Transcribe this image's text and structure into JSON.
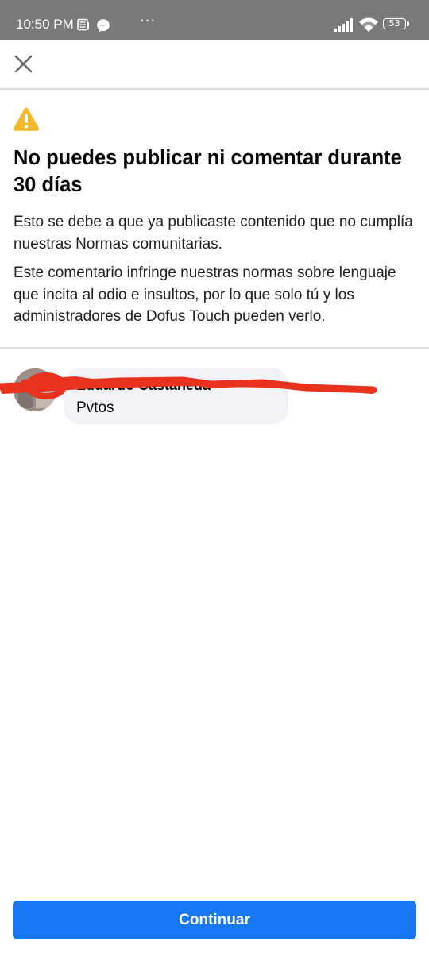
{
  "status_bar": {
    "time": "10:50 PM",
    "icons": [
      "news-icon",
      "messenger-icon",
      "more-dots-icon",
      "signal-icon",
      "wifi-icon",
      "battery-icon"
    ],
    "more": "···",
    "battery": "53",
    "background": "#7a7a7a"
  },
  "top_bar": {
    "close_icon": "close-icon"
  },
  "restriction": {
    "icon": "warning-icon",
    "icon_color": "#f7b928",
    "title": "No puedes publicar ni comentar durante 30 días",
    "paragraph_1": "Esto se debe a que ya publicaste contenido que no cumplía nuestras Normas comunitarias.",
    "paragraph_2": "Este comentario infringe nuestras normas sobre lenguaje que incita al odio e insultos, por lo que solo tú y los administradores de Dofus Touch pueden verlo."
  },
  "comment": {
    "author": "Eduardo Castañeda",
    "text": "Pvtos",
    "author_redacted": true,
    "redaction_color": "#e8321e"
  },
  "actions": {
    "continue_label": "Continuar",
    "continue_color": "#1877f2"
  }
}
